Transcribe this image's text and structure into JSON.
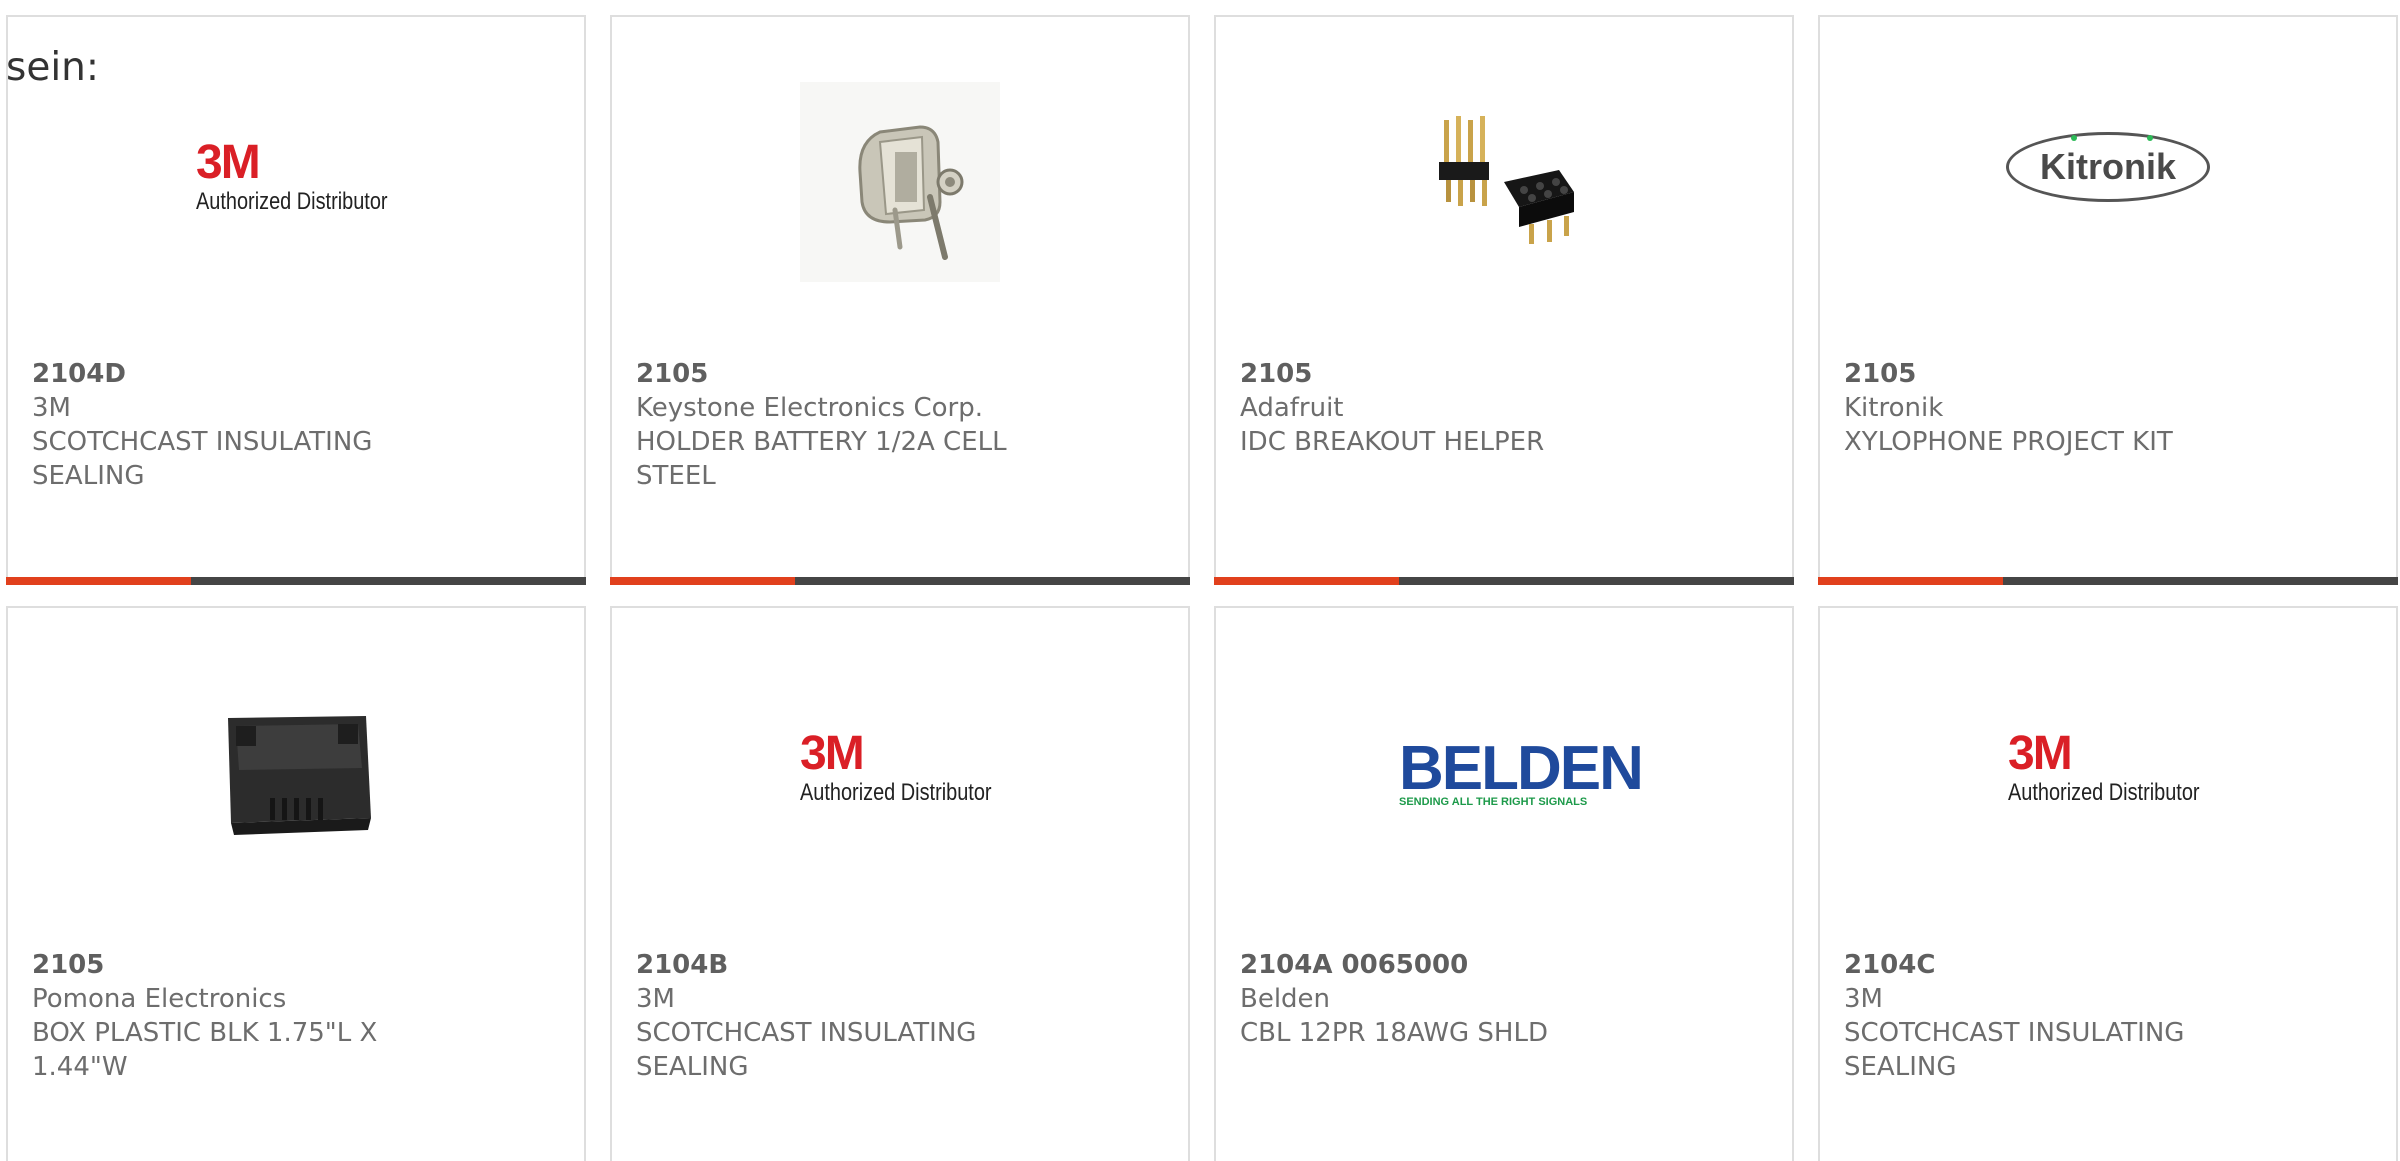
{
  "caption": "sein:",
  "colors": {
    "accent": "#e1401d",
    "bar": "#454545",
    "border": "#dedede",
    "text": "#6d6d6d",
    "logo_3m_red": "#da1f26",
    "belden_blue": "#1f4a9c",
    "belden_green": "#1d9a4a",
    "kitronik_green": "#2cba57"
  },
  "logos": {
    "three_m": {
      "mark": "3M",
      "tagline": "Authorized Distributor"
    },
    "belden": {
      "mark": "BELDEN",
      "tagline": "SENDING ALL THE RIGHT SIGNALS"
    },
    "kitronik": {
      "mark": "Kitronik"
    }
  },
  "products": [
    {
      "image": "3m-authorized-distributor-logo",
      "part_number": "2104D",
      "manufacturer": "3M",
      "description": "SCOTCHCAST INSULATING SEALING"
    },
    {
      "image": "battery-holder-photo",
      "part_number": "2105",
      "manufacturer": "Keystone Electronics Corp.",
      "description": "HOLDER BATTERY 1/2A CELL STEEL"
    },
    {
      "image": "pin-header-photo",
      "part_number": "2105",
      "manufacturer": "Adafruit",
      "description": "IDC BREAKOUT HELPER"
    },
    {
      "image": "kitronik-logo",
      "part_number": "2105",
      "manufacturer": "Kitronik",
      "description": "XYLOPHONE PROJECT KIT"
    },
    {
      "image": "plastic-box-photo",
      "part_number": "2105",
      "manufacturer": "Pomona Electronics",
      "description": "BOX PLASTIC BLK 1.75\"L X 1.44\"W"
    },
    {
      "image": "3m-authorized-distributor-logo",
      "part_number": "2104B",
      "manufacturer": "3M",
      "description": "SCOTCHCAST INSULATING SEALING"
    },
    {
      "image": "belden-logo",
      "part_number": "2104A 0065000",
      "manufacturer": "Belden",
      "description": "CBL 12PR 18AWG SHLD"
    },
    {
      "image": "3m-authorized-distributor-logo",
      "part_number": "2104C",
      "manufacturer": "3M",
      "description": "SCOTCHCAST INSULATING SEALING"
    }
  ]
}
